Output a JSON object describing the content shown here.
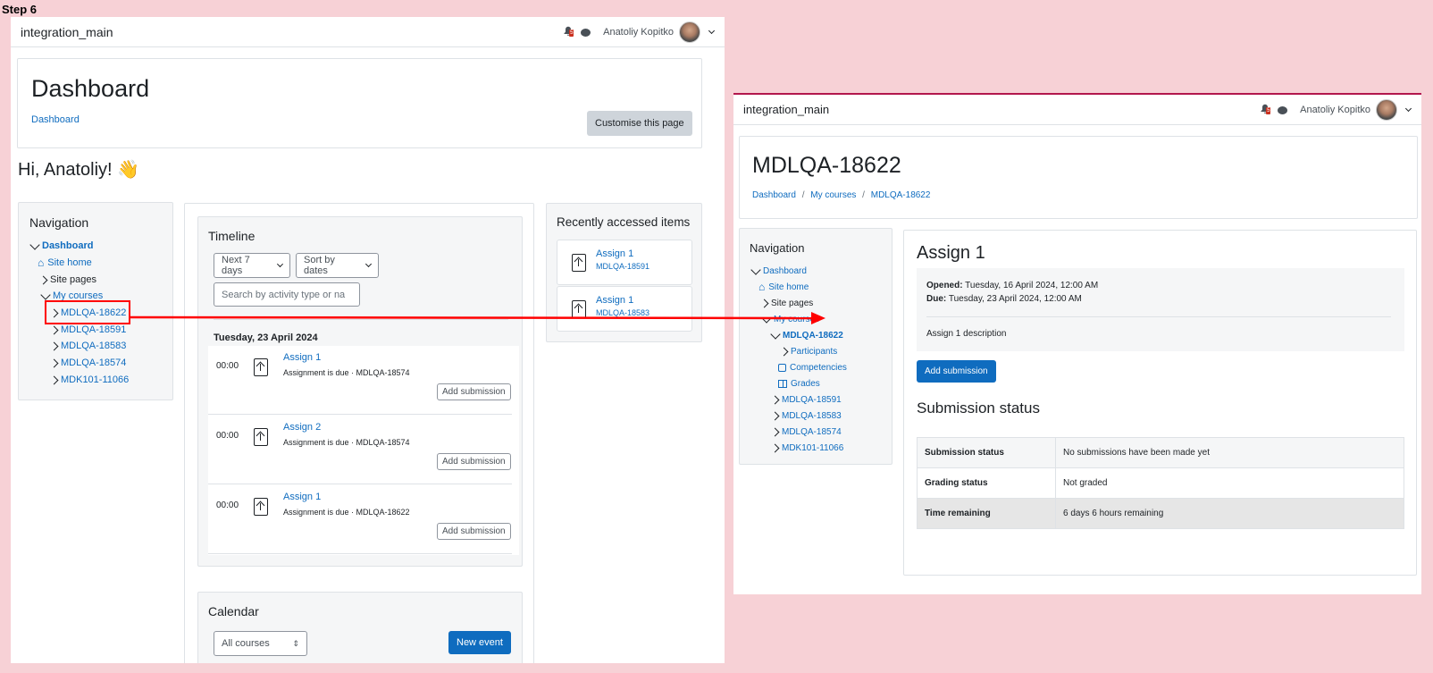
{
  "step_label": "Step 6",
  "left": {
    "brand": "integration_main",
    "notif_count": "5",
    "user_name": "Anatoliy Kopitko",
    "page_title": "Dashboard",
    "breadcrumb": "Dashboard",
    "customise_btn": "Customise this page",
    "greeting": "Hi, Anatoliy! 👋",
    "nav": {
      "title": "Navigation",
      "dashboard": "Dashboard",
      "site_home": "Site home",
      "site_pages": "Site pages",
      "my_courses": "My courses",
      "courses": [
        "MDLQA-18622",
        "MDLQA-18591",
        "MDLQA-18583",
        "MDLQA-18574",
        "MDK101-11066"
      ]
    },
    "timeline": {
      "title": "Timeline",
      "filter": "Next 7 days",
      "sort": "Sort by dates",
      "search_placeholder": "Search by activity type or na",
      "date": "Tuesday, 23 April 2024",
      "items": [
        {
          "time": "00:00",
          "name": "Assign 1",
          "desc": "Assignment is due · MDLQA-18574",
          "action": "Add submission"
        },
        {
          "time": "00:00",
          "name": "Assign 2",
          "desc": "Assignment is due · MDLQA-18574",
          "action": "Add submission"
        },
        {
          "time": "00:00",
          "name": "Assign 1",
          "desc": "Assignment is due · MDLQA-18622",
          "action": "Add submission"
        }
      ]
    },
    "recent": {
      "title": "Recently accessed items",
      "items": [
        {
          "name": "Assign 1",
          "course": "MDLQA-18591"
        },
        {
          "name": "Assign 1",
          "course": "MDLQA-18583"
        }
      ]
    },
    "calendar": {
      "title": "Calendar",
      "select": "All courses",
      "new_event": "New event"
    }
  },
  "right": {
    "brand": "integration_main",
    "notif_count": "5",
    "user_name": "Anatoliy Kopitko",
    "page_title": "MDLQA-18622",
    "breadcrumb": [
      "Dashboard",
      "My courses",
      "MDLQA-18622"
    ],
    "nav": {
      "title": "Navigation",
      "dashboard": "Dashboard",
      "site_home": "Site home",
      "site_pages": "Site pages",
      "my_courses": "My courses",
      "current_course": "MDLQA-18622",
      "sub": [
        "Participants",
        "Competencies",
        "Grades"
      ],
      "courses": [
        "MDLQA-18591",
        "MDLQA-18583",
        "MDLQA-18574",
        "MDK101-11066"
      ]
    },
    "assign": {
      "title": "Assign 1",
      "opened_label": "Opened:",
      "opened_value": "Tuesday, 16 April 2024, 12:00 AM",
      "due_label": "Due:",
      "due_value": "Tuesday, 23 April 2024, 12:00 AM",
      "description": "Assign 1 description",
      "add_submission": "Add submission",
      "status_title": "Submission status",
      "rows": [
        {
          "k": "Submission status",
          "v": "No submissions have been made yet"
        },
        {
          "k": "Grading status",
          "v": "Not graded"
        },
        {
          "k": "Time remaining",
          "v": "6 days 6 hours remaining"
        }
      ]
    }
  },
  "colors": {
    "accent": "#0f6cbf",
    "highlight": "#ff0000",
    "background": "#f7d1d6"
  }
}
